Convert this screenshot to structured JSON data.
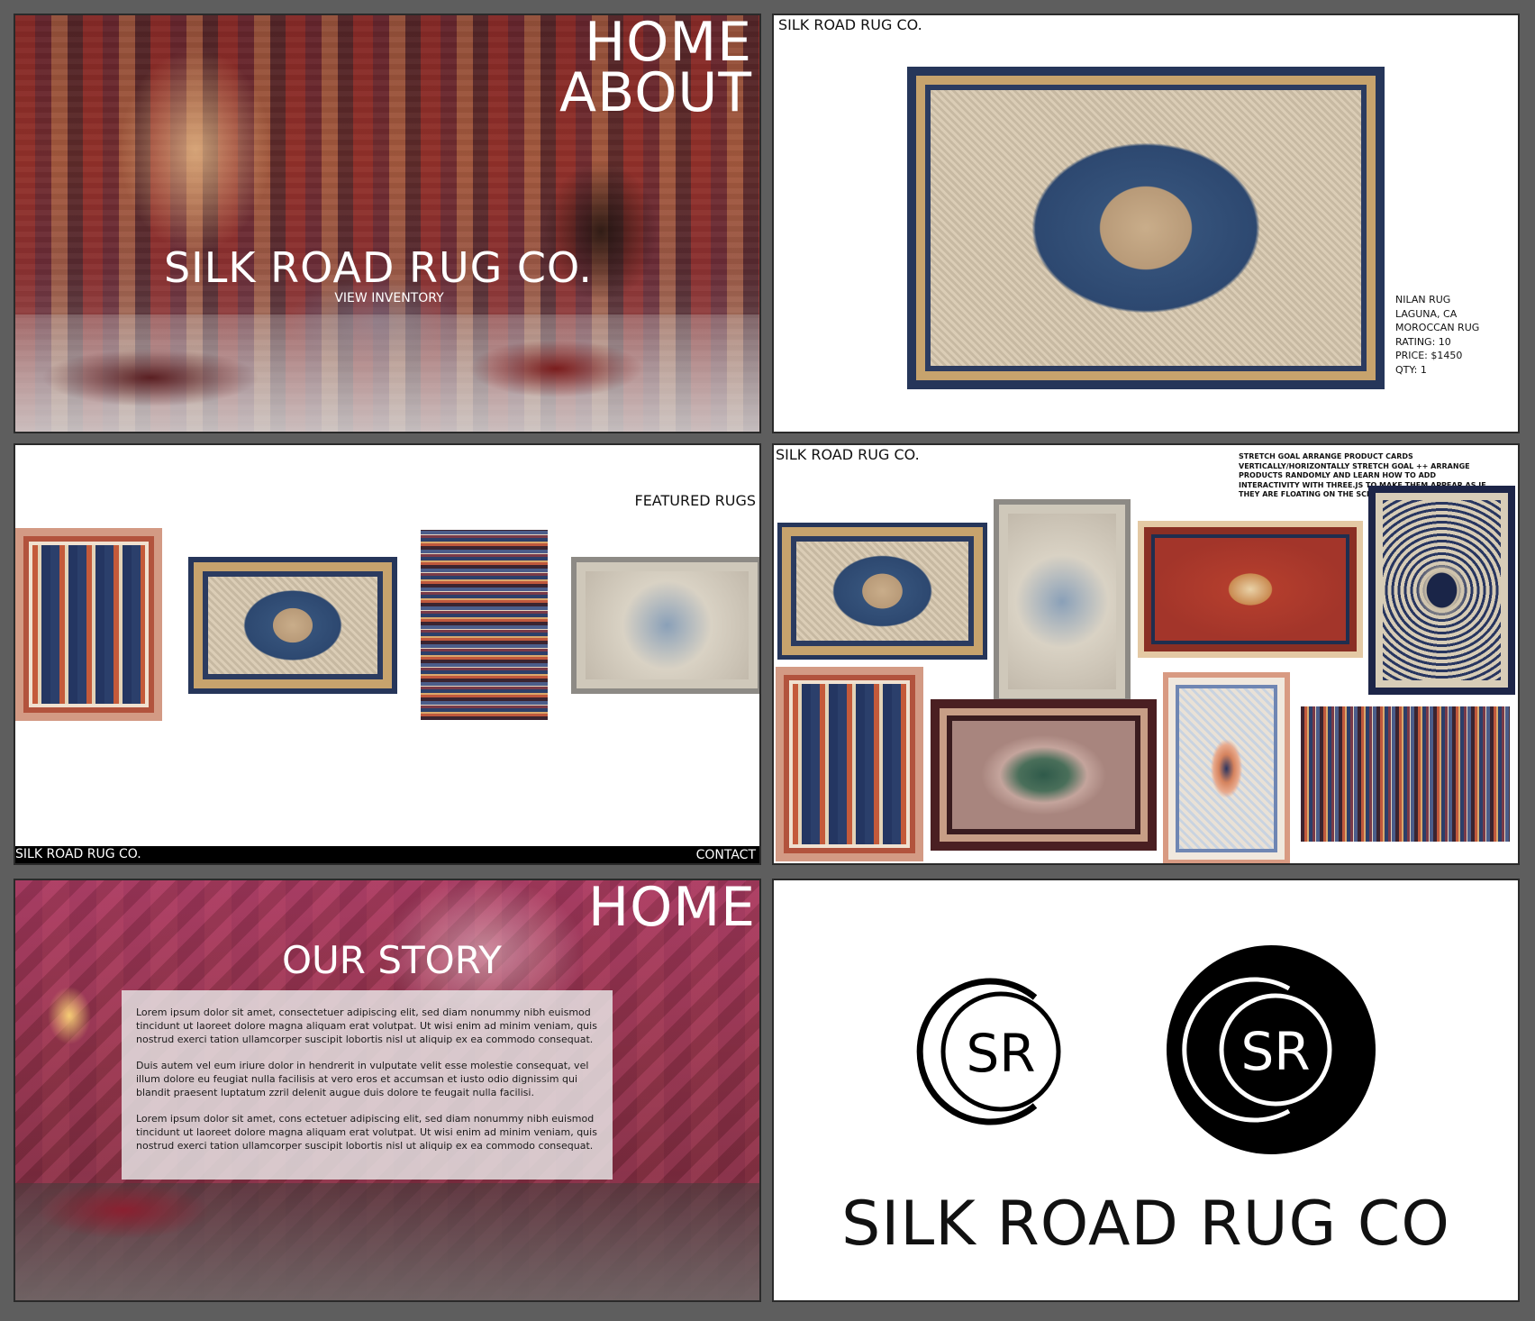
{
  "home_panel": {
    "nav": [
      "HOME",
      "ABOUT"
    ],
    "title": "SILK ROAD RUG CO.",
    "cta": "VIEW INVENTORY"
  },
  "product_panel": {
    "brand": "SILK ROAD RUG CO.",
    "product": {
      "name": "NILAN RUG",
      "location": "LAGUNA, CA",
      "style": "MOROCCAN RUG",
      "rating": "RATING: 10",
      "price": "PRICE: $1450",
      "qty": "QTY: 1"
    }
  },
  "featured_panel": {
    "heading": "FEATURED RUGS",
    "footer_brand": "SILK ROAD RUG CO.",
    "footer_contact": "CONTACT"
  },
  "inventory_panel": {
    "brand": "SILK ROAD RUG CO.",
    "note": "STRETCH GOAL ARRANGE PRODUCT CARDS VERTICALLY/HORIZONTALLY STRETCH GOAL ++ ARRANGE PRODUCTS RANDOMLY AND LEARN HOW TO ADD INTERACTIVITY WITH THREE.JS TO MAKE THEM APPEAR AS IF THEY ARE FLOATING ON THE SCREEN"
  },
  "story_panel": {
    "nav": "HOME",
    "title": "OUR STORY",
    "paragraphs": [
      "Lorem ipsum dolor sit amet, consectetuer adipiscing elit, sed diam nonummy nibh euismod tincidunt ut laoreet dolore magna aliquam erat volutpat. Ut wisi enim ad minim veniam, quis nostrud exerci tation ullamcorper suscipit lobortis nisl ut aliquip ex ea commodo consequat.",
      "Duis autem vel eum iriure dolor in hendrerit in vulputate velit esse molestie consequat, vel illum dolore eu feugiat nulla facilisis at vero eros et accumsan et iusto odio dignissim qui blandit praesent luptatum zzril delenit augue duis dolore te feugait nulla facilisi.",
      "Lorem ipsum dolor sit amet, cons ectetuer adipiscing elit, sed diam nonummy nibh euismod tincidunt ut laoreet dolore magna aliquam erat volutpat. Ut wisi enim ad minim veniam, quis nostrud exerci tation ullamcorper suscipit lobortis nisl ut aliquip ex ea commodo consequat."
    ]
  },
  "logo_panel": {
    "monogram": "SR",
    "wordmark": "SILK ROAD RUG CO"
  }
}
